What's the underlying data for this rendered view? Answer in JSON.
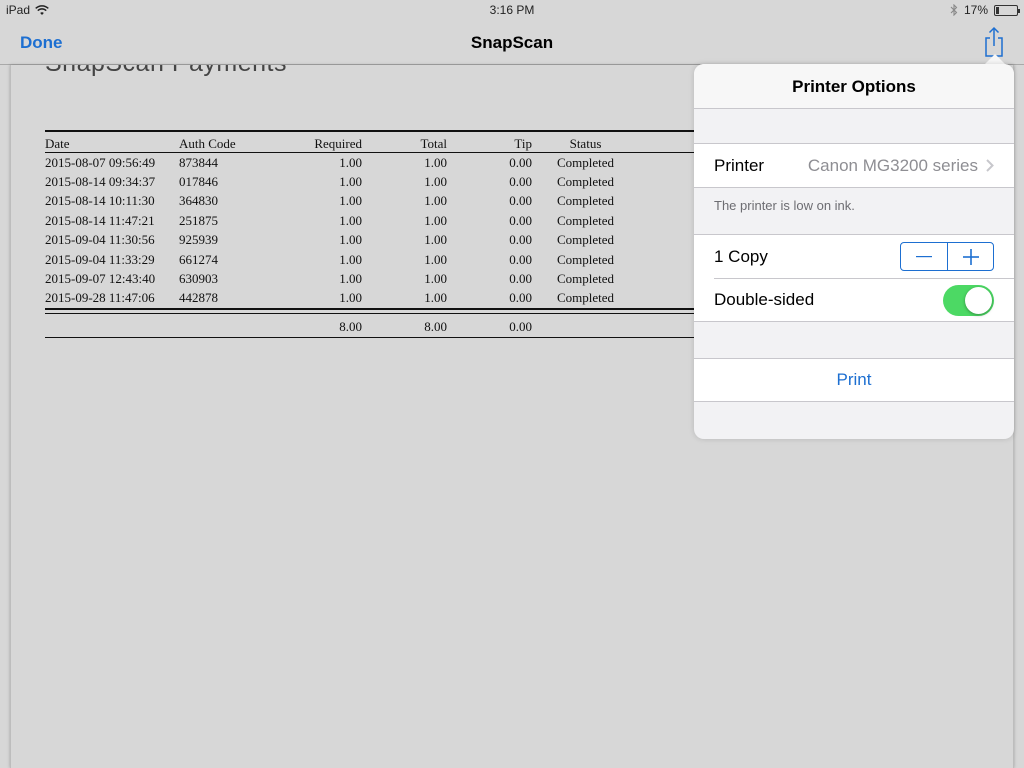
{
  "status_bar": {
    "device": "iPad",
    "time": "3:16 PM",
    "battery": "17%",
    "battery_level": 0.17
  },
  "navbar": {
    "done_label": "Done",
    "title": "SnapScan"
  },
  "document": {
    "title": "SnapScan Payments",
    "columns": [
      "Date",
      "Auth Code",
      "Required",
      "Total",
      "Tip",
      "Status"
    ],
    "rows": [
      [
        "2015-08-07 09:56:49",
        "873844",
        "1.00",
        "1.00",
        "0.00",
        "Completed"
      ],
      [
        "2015-08-14 09:34:37",
        "017846",
        "1.00",
        "1.00",
        "0.00",
        "Completed"
      ],
      [
        "2015-08-14 10:11:30",
        "364830",
        "1.00",
        "1.00",
        "0.00",
        "Completed"
      ],
      [
        "2015-08-14 11:47:21",
        "251875",
        "1.00",
        "1.00",
        "0.00",
        "Completed"
      ],
      [
        "2015-09-04 11:30:56",
        "925939",
        "1.00",
        "1.00",
        "0.00",
        "Completed"
      ],
      [
        "2015-09-04 11:33:29",
        "661274",
        "1.00",
        "1.00",
        "0.00",
        "Completed"
      ],
      [
        "2015-09-07 12:43:40",
        "630903",
        "1.00",
        "1.00",
        "0.00",
        "Completed"
      ],
      [
        "2015-09-28 11:47:06",
        "442878",
        "1.00",
        "1.00",
        "0.00",
        "Completed"
      ]
    ],
    "totals": {
      "required": "8.00",
      "total": "8.00",
      "tip": "0.00"
    }
  },
  "printer_options": {
    "title": "Printer Options",
    "printer_label": "Printer",
    "printer_value": "Canon MG3200 series",
    "ink_note": "The printer is low on ink.",
    "copies_label": "1 Copy",
    "double_sided_label": "Double-sided",
    "double_sided_on": true,
    "print_label": "Print"
  },
  "colors": {
    "accent": "#1d6fd1",
    "toggle_on": "#4cd964"
  }
}
